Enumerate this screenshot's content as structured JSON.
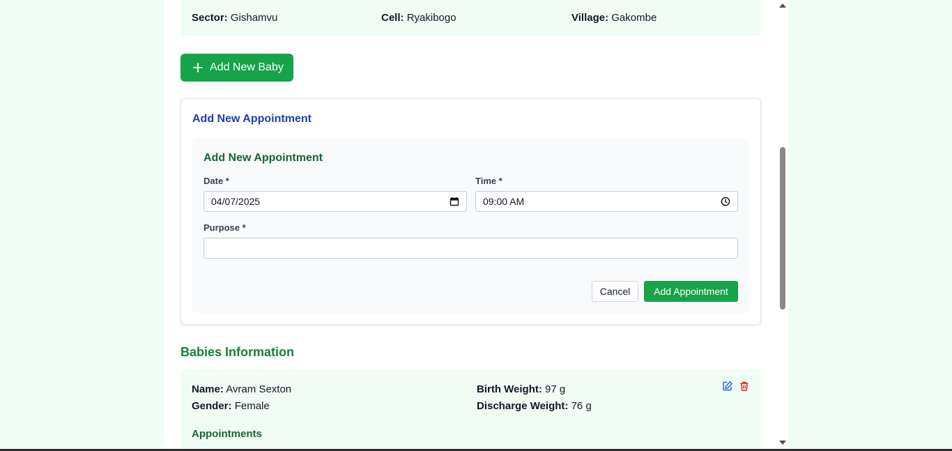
{
  "location": {
    "sector_label": "Sector:",
    "sector_value": "Gishamvu",
    "cell_label": "Cell:",
    "cell_value": "Ryakibogo",
    "village_label": "Village:",
    "village_value": "Gakombe"
  },
  "add_baby_button": {
    "icon": "plus-icon",
    "label": "Add New Baby"
  },
  "appointment_card": {
    "title": "Add New Appointment",
    "form": {
      "title": "Add New Appointment",
      "date_label": "Date *",
      "date_value": "04/07/2025",
      "time_label": "Time *",
      "time_value": "09:00 AM",
      "purpose_label": "Purpose *",
      "purpose_value": "",
      "cancel_label": "Cancel",
      "submit_label": "Add Appointment"
    }
  },
  "babies": {
    "title": "Babies Information",
    "items": [
      {
        "name_label": "Name:",
        "name": "Avram Sexton",
        "gender_label": "Gender:",
        "gender": "Female",
        "birth_weight_label": "Birth Weight:",
        "birth_weight": "97 g",
        "discharge_weight_label": "Discharge Weight:",
        "discharge_weight": "76 g",
        "appointments_title": "Appointments"
      }
    ]
  },
  "colors": {
    "primary_green": "#16a34a",
    "heading_blue": "#1e40af",
    "heading_green": "#166534",
    "background": "#f0fdf4",
    "edit_icon": "#2563eb",
    "delete_icon": "#dc2626"
  }
}
